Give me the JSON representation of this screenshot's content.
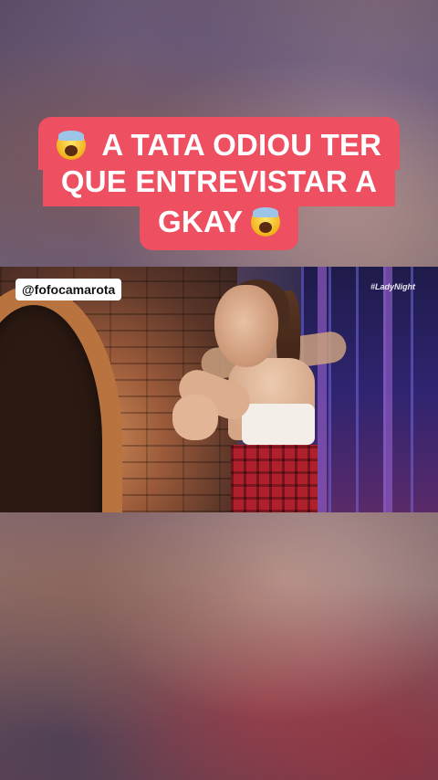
{
  "caption": {
    "line1": "A TATA ODIOU TER",
    "line2": "QUE ENTREVISTAR A",
    "line3": "GKAY",
    "emoji_icon": "face-screaming-in-fear-icon",
    "background_color": "#ee5061"
  },
  "video": {
    "account_tag": "@fofocamarota",
    "watermark": "#LadyNight"
  }
}
